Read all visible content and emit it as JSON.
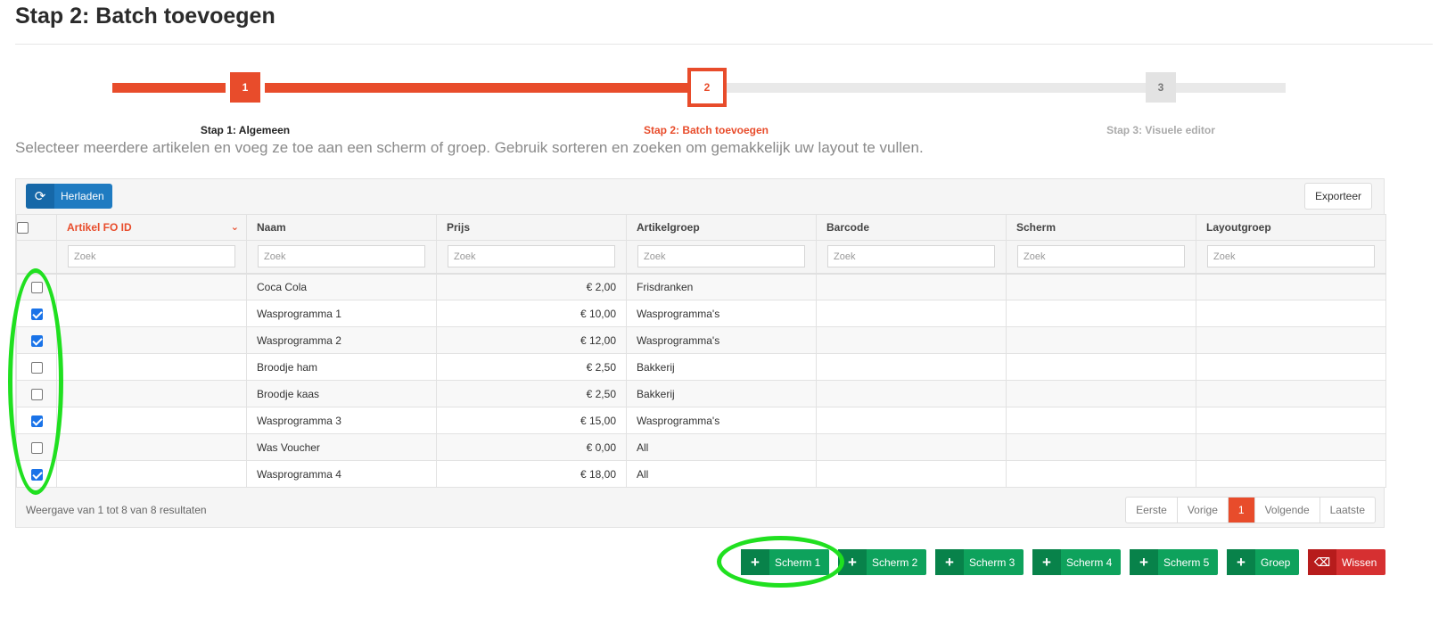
{
  "page": {
    "title": "Stap 2: Batch toevoegen",
    "intro": "Selecteer meerdere artikelen en voeg ze toe aan een scherm of groep. Gebruik sorteren en zoeken om gemakkelijk uw layout te vullen."
  },
  "wizard": {
    "steps": [
      {
        "number": "1",
        "label": "Stap 1: Algemeen",
        "state": "done"
      },
      {
        "number": "2",
        "label": "Stap 2: Batch toevoegen",
        "state": "active"
      },
      {
        "number": "3",
        "label": "Stap 3: Visuele editor",
        "state": "todo"
      }
    ]
  },
  "toolbar": {
    "reload_label": "Herladen",
    "export_label": "Exporteer",
    "reload_icon": "refresh-icon"
  },
  "table": {
    "columns": [
      "Artikel FO ID",
      "Naam",
      "Prijs",
      "Artikelgroep",
      "Barcode",
      "Scherm",
      "Layoutgroep"
    ],
    "sorted_column": "Artikel FO ID",
    "filter_placeholder": "Zoek",
    "rows": [
      {
        "checked": false,
        "id": "",
        "naam": "Coca Cola",
        "prijs": "€ 2,00",
        "groep": "Frisdranken",
        "barcode": "",
        "scherm": "",
        "layoutgroep": ""
      },
      {
        "checked": true,
        "id": "",
        "naam": "Wasprogramma 1",
        "prijs": "€ 10,00",
        "groep": "Wasprogramma's",
        "barcode": "",
        "scherm": "",
        "layoutgroep": ""
      },
      {
        "checked": true,
        "id": "",
        "naam": "Wasprogramma 2",
        "prijs": "€ 12,00",
        "groep": "Wasprogramma's",
        "barcode": "",
        "scherm": "",
        "layoutgroep": ""
      },
      {
        "checked": false,
        "id": "",
        "naam": "Broodje ham",
        "prijs": "€ 2,50",
        "groep": "Bakkerij",
        "barcode": "",
        "scherm": "",
        "layoutgroep": ""
      },
      {
        "checked": false,
        "id": "",
        "naam": "Broodje kaas",
        "prijs": "€ 2,50",
        "groep": "Bakkerij",
        "barcode": "",
        "scherm": "",
        "layoutgroep": ""
      },
      {
        "checked": true,
        "id": "",
        "naam": "Wasprogramma 3",
        "prijs": "€ 15,00",
        "groep": "Wasprogramma's",
        "barcode": "",
        "scherm": "",
        "layoutgroep": ""
      },
      {
        "checked": false,
        "id": "",
        "naam": "Was Voucher",
        "prijs": "€ 0,00",
        "groep": "All",
        "barcode": "",
        "scherm": "",
        "layoutgroep": ""
      },
      {
        "checked": true,
        "id": "",
        "naam": "Wasprogramma 4",
        "prijs": "€ 18,00",
        "groep": "All",
        "barcode": "",
        "scherm": "",
        "layoutgroep": ""
      }
    ],
    "info": "Weergave van 1 tot 8 van 8 resultaten"
  },
  "pager": {
    "first": "Eerste",
    "prev": "Vorige",
    "current": "1",
    "next": "Volgende",
    "last": "Laatste"
  },
  "actions": [
    {
      "label": "Scherm 1",
      "icon": "plus-icon",
      "color": "#0ea25c"
    },
    {
      "label": "Scherm 2",
      "icon": "plus-icon",
      "color": "#0ea25c"
    },
    {
      "label": "Scherm 3",
      "icon": "plus-icon",
      "color": "#0ea25c"
    },
    {
      "label": "Scherm 4",
      "icon": "plus-icon",
      "color": "#0ea25c"
    },
    {
      "label": "Scherm 5",
      "icon": "plus-icon",
      "color": "#0ea25c"
    },
    {
      "label": "Groep",
      "icon": "plus-icon",
      "color": "#0ea25c"
    },
    {
      "label": "Wissen",
      "icon": "eraser-icon",
      "color": "#d63031"
    }
  ],
  "colors": {
    "accent": "#e84c2b",
    "primary": "#1f7bc1",
    "success": "#0ea25c",
    "danger": "#d63031",
    "highlight": "#20e020"
  }
}
